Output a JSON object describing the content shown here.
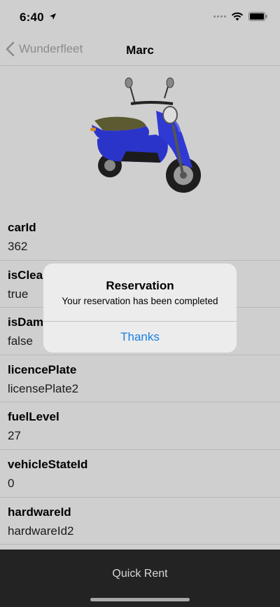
{
  "status_bar": {
    "time": "6:40"
  },
  "nav": {
    "back_label": "Wunderfleet",
    "title": "Marc"
  },
  "vehicle": {
    "image_icon": "scooter-image",
    "accent_color": "#2b34c8"
  },
  "fields": [
    {
      "key": "carId",
      "value": "362"
    },
    {
      "key": "isClea",
      "value": "true"
    },
    {
      "key": "isDam",
      "value": "false"
    },
    {
      "key": "licencePlate",
      "value": "licensePlate2"
    },
    {
      "key": "fuelLevel",
      "value": "27"
    },
    {
      "key": "vehicleStateId",
      "value": "0"
    },
    {
      "key": "hardwareId",
      "value": "hardwareId2"
    }
  ],
  "bottom": {
    "action_label": "Quick Rent"
  },
  "alert": {
    "title": "Reservation",
    "message": "Your reservation has been completed",
    "button_label": "Thanks",
    "button_color": "#1a80e6"
  }
}
